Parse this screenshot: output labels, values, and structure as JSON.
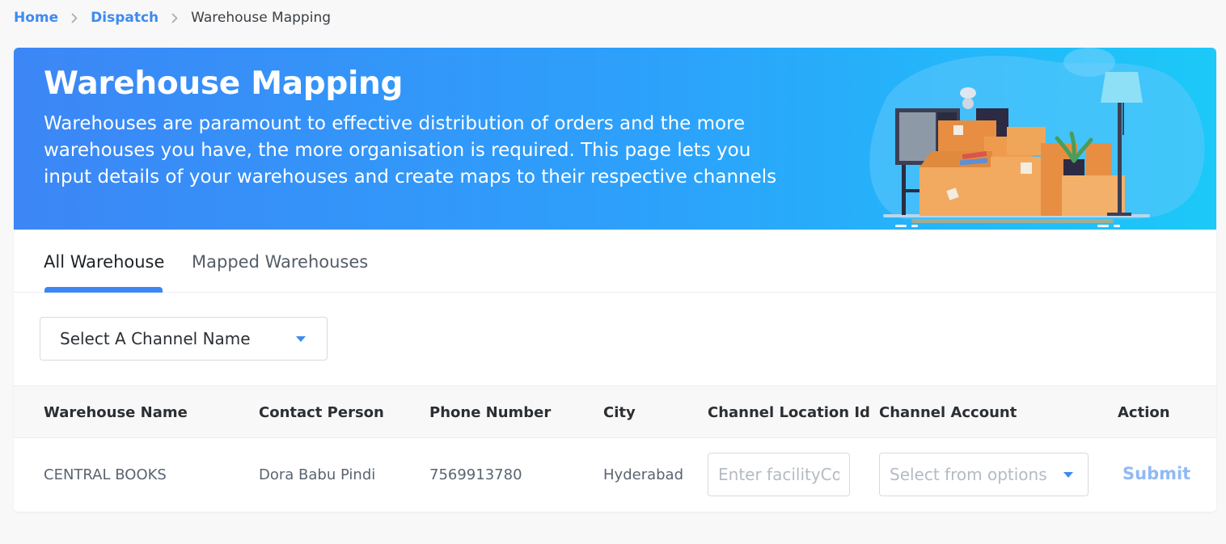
{
  "breadcrumb": {
    "home": "Home",
    "dispatch": "Dispatch",
    "current": "Warehouse Mapping"
  },
  "banner": {
    "title": "Warehouse Mapping",
    "description": "Warehouses are paramount to effective distribution of orders and the more warehouses you have, the more organisation is required. This page lets you input details of your warehouses and create maps to their respective channels"
  },
  "tabs": {
    "all": "All Warehouse",
    "mapped": "Mapped Warehouses",
    "active": "all"
  },
  "filter": {
    "channel_select_label": "Select A Channel Name"
  },
  "table": {
    "headers": [
      "Warehouse Name",
      "Contact Person",
      "Phone Number",
      "City",
      "Channel Location Id",
      "Channel Account",
      "Action"
    ],
    "rows": [
      {
        "warehouse_name": "CENTRAL BOOKS",
        "contact_person": "Dora Babu Pindi",
        "phone_number": "7569913780",
        "city": "Hyderabad",
        "location_placeholder": "Enter facilityCode",
        "account_placeholder": "Select from options",
        "action_label": "Submit"
      }
    ]
  },
  "colors": {
    "accent": "#3c86f6",
    "link": "#3d8bf2",
    "banner_start": "#3c86f6",
    "banner_end": "#1cc9f8",
    "submit_disabled": "#8fbaf5"
  },
  "icons": {
    "breadcrumb_separator": "chevron-right-icon",
    "select_caret": "caret-down-icon"
  }
}
